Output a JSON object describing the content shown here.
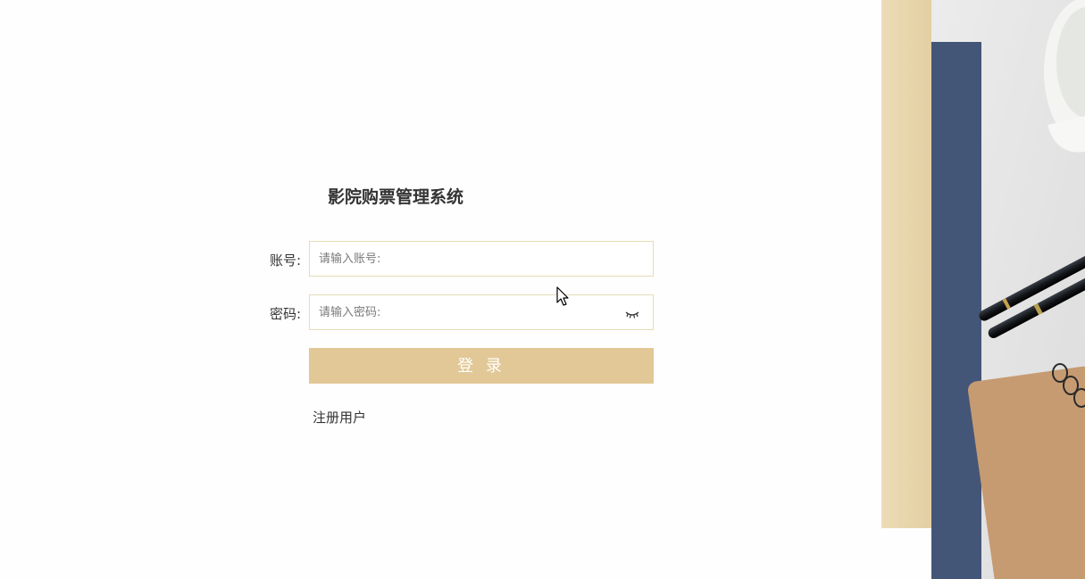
{
  "app": {
    "title": "影院购票管理系统"
  },
  "form": {
    "account_label": "账号:",
    "account_placeholder": "请输入账号:",
    "account_value": "",
    "password_label": "密码:",
    "password_placeholder": "请输入密码:",
    "password_value": "",
    "password_toggle_icon": "eye-closed-icon",
    "login_label": "登 录",
    "register_label": "注册用户"
  },
  "colors": {
    "accent": "#e1c896",
    "input_border": "#e4ddb6",
    "panel_navy": "#445677",
    "panel_beige": "#e8d6ae",
    "notebook_kraft": "#c69b72"
  }
}
